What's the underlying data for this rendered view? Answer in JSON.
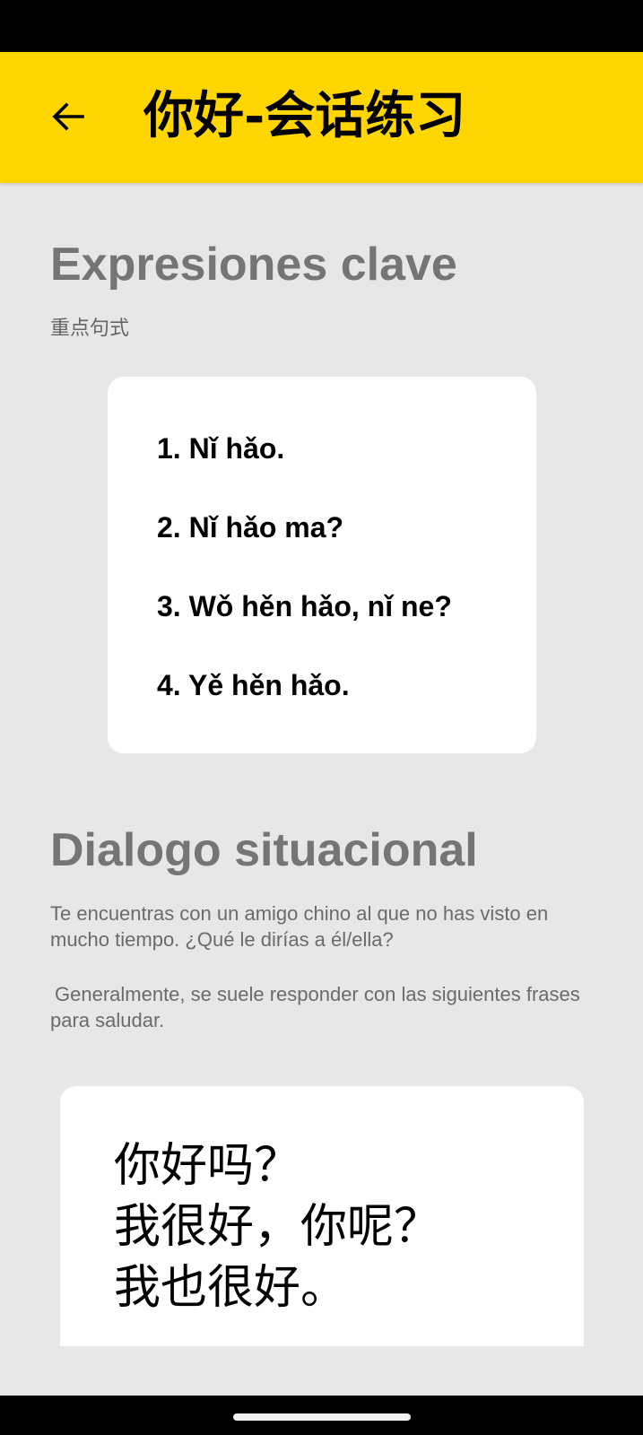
{
  "header": {
    "title": "你好-会话练习",
    "back_icon": "arrow-left-icon"
  },
  "key_expressions": {
    "title": "Expresiones clave",
    "subtitle": "重点句式",
    "items": [
      "1. Nǐ hǎo.",
      "2. Nǐ hǎo ma?",
      "3. Wǒ hěn hǎo, nǐ ne?",
      "4. Yě hěn hǎo."
    ]
  },
  "dialog": {
    "title": "Dialogo situacional",
    "description_1": "Te encuentras con un amigo chino al que no has visto en mucho tiempo. ¿Qué le dirías a él/ella?",
    "description_2": "Generalmente, se suele responder con las siguientes frases para saludar.",
    "lines": [
      "你好吗？",
      "我很好，你呢？",
      "我也很好。"
    ]
  },
  "colors": {
    "app_bar": "#ffd600",
    "background": "#e7e7e7",
    "section_title": "#757575"
  }
}
